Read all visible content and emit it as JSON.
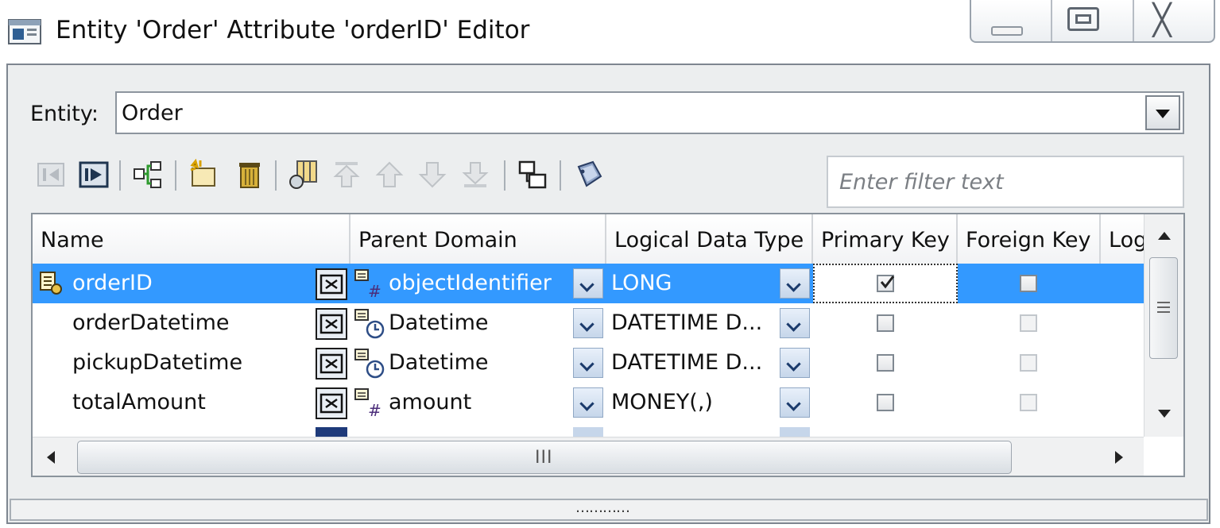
{
  "window": {
    "title": "Entity 'Order' Attribute 'orderID' Editor",
    "close_glyph": "╳"
  },
  "entity": {
    "label": "Entity:",
    "value": "Order"
  },
  "filter": {
    "placeholder": "Enter filter text"
  },
  "toolbar": {
    "icons": [
      "nav-prev-icon",
      "nav-next-icon",
      "hierarchy-icon",
      "new-attribute-icon",
      "delete-icon",
      "columns-icon",
      "move-top-icon",
      "move-up-icon",
      "move-down-icon",
      "move-bottom-icon",
      "diagram-icon",
      "edit-tag-icon"
    ]
  },
  "table": {
    "columns": [
      "Name",
      "Parent Domain",
      "Logical Data Type",
      "Primary Key",
      "Foreign Key",
      "Log"
    ],
    "rows": [
      {
        "name": "orderID",
        "domain": "objectIdentifier",
        "domain_kind": "#",
        "type": "LONG",
        "pk": true,
        "fk": false,
        "selected": true
      },
      {
        "name": "orderDatetime",
        "domain": "Datetime",
        "domain_kind": "clock",
        "type": "DATETIME D...",
        "pk": false,
        "fk": false,
        "selected": false
      },
      {
        "name": "pickupDatetime",
        "domain": "Datetime",
        "domain_kind": "clock",
        "type": "DATETIME D...",
        "pk": false,
        "fk": false,
        "selected": false
      },
      {
        "name": "totalAmount",
        "domain": "amount",
        "domain_kind": "#",
        "type": "MONEY(,)",
        "pk": false,
        "fk": false,
        "selected": false
      }
    ],
    "hscroll_grip": "III"
  },
  "statusbar": {
    "grip": "…………"
  },
  "colors": {
    "selection": "#3399ff",
    "frame": "#eceeef"
  }
}
